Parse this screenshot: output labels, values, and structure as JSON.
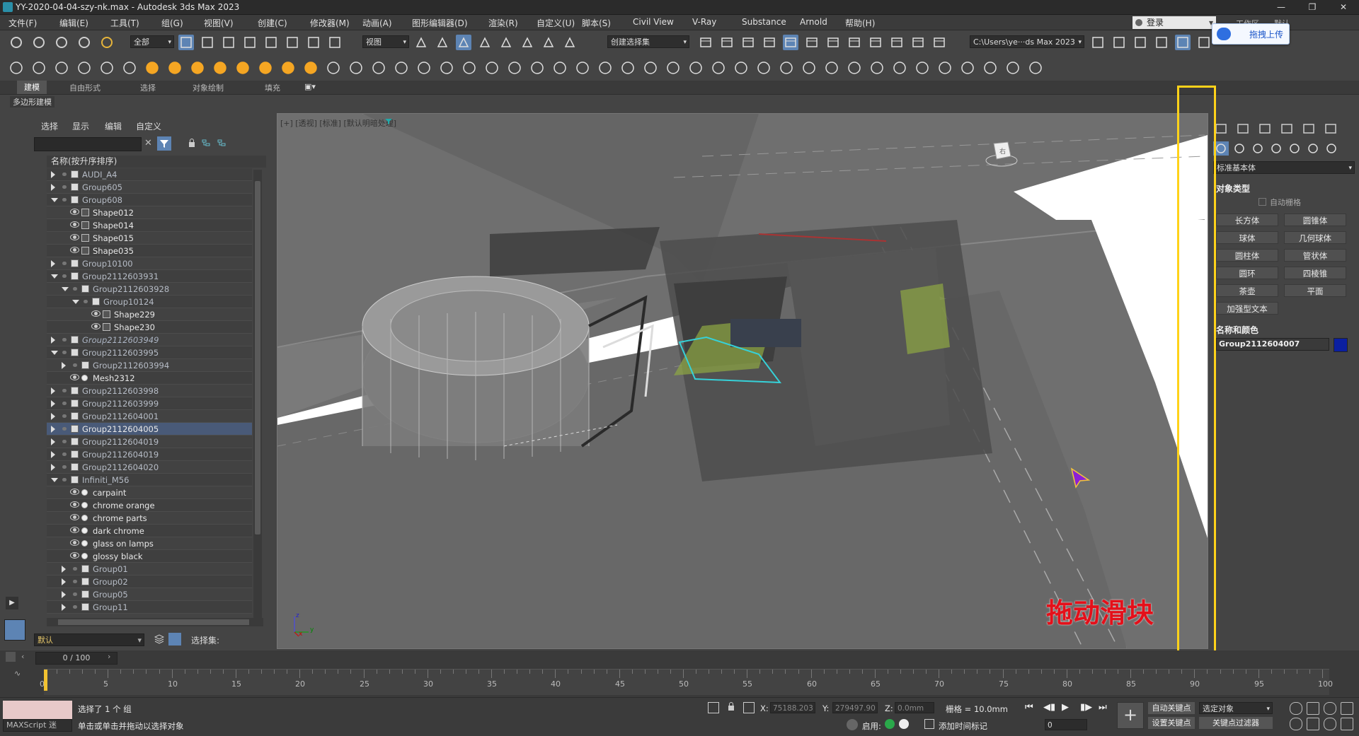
{
  "window": {
    "title": "YY-2020-04-04-szy-nk.max - Autodesk 3ds Max 2023",
    "minimize": "—",
    "restore": "❐",
    "close": "✕"
  },
  "menu": [
    "文件(F)",
    "编辑(E)",
    "工具(T)",
    "组(G)",
    "视图(V)",
    "创建(C)",
    "修改器(M)",
    "动画(A)",
    "图形编辑器(D)",
    "渲染(R)",
    "自定义(U)",
    "脚本(S)",
    "Civil View",
    "V-Ray",
    "Substance",
    "Arnold",
    "帮助(H)"
  ],
  "login": {
    "label": "登录",
    "right_tab": "工作区",
    "right_tab2": "默认"
  },
  "upload_popup": {
    "label": "拖拽上传"
  },
  "toolbar1": {
    "filter": "全部",
    "ref_coord": "视图",
    "selection_set": "创建选择集",
    "path": "C:\\Users\\ye···ds Max 2023"
  },
  "ribbon": {
    "tabs": [
      "建模",
      "自由形式",
      "选择",
      "对象绘制",
      "填充"
    ],
    "subtab": "多边形建模"
  },
  "scene_explorer": {
    "tabs": [
      "选择",
      "显示",
      "编辑",
      "自定义"
    ],
    "column_header": "名称(按升序排序)",
    "rows": [
      {
        "name": "AUDI_A4",
        "level": 0,
        "exp": "closed",
        "eye": false,
        "ic": "group",
        "style": "dim"
      },
      {
        "name": "Group605",
        "level": 0,
        "exp": "closed",
        "eye": false,
        "ic": "group",
        "style": "dim"
      },
      {
        "name": "Group608",
        "level": 0,
        "exp": "open",
        "eye": false,
        "ic": "group",
        "style": "dim"
      },
      {
        "name": "Shape012",
        "level": 1,
        "exp": "none",
        "eye": true,
        "ic": "shape",
        "style": "normal"
      },
      {
        "name": "Shape014",
        "level": 1,
        "exp": "none",
        "eye": true,
        "ic": "shape",
        "style": "normal"
      },
      {
        "name": "Shape015",
        "level": 1,
        "exp": "none",
        "eye": true,
        "ic": "shape",
        "style": "normal"
      },
      {
        "name": "Shape035",
        "level": 1,
        "exp": "none",
        "eye": true,
        "ic": "shape",
        "style": "normal"
      },
      {
        "name": "Group10100",
        "level": 0,
        "exp": "closed",
        "eye": false,
        "ic": "group",
        "style": "dim"
      },
      {
        "name": "Group2112603931",
        "level": 0,
        "exp": "open",
        "eye": false,
        "ic": "group",
        "style": "dim"
      },
      {
        "name": "Group2112603928",
        "level": 1,
        "exp": "open",
        "eye": false,
        "ic": "group",
        "style": "dim"
      },
      {
        "name": "Group10124",
        "level": 2,
        "exp": "open",
        "eye": false,
        "ic": "group",
        "style": "dim"
      },
      {
        "name": "Shape229",
        "level": 3,
        "exp": "none",
        "eye": true,
        "ic": "shape",
        "style": "normal"
      },
      {
        "name": "Shape230",
        "level": 3,
        "exp": "none",
        "eye": true,
        "ic": "shape",
        "style": "normal"
      },
      {
        "name": "Group2112603949",
        "level": 0,
        "exp": "closed",
        "eye": false,
        "ic": "group",
        "style": "it"
      },
      {
        "name": "Group2112603995",
        "level": 0,
        "exp": "open",
        "eye": false,
        "ic": "group",
        "style": "dim"
      },
      {
        "name": "Group2112603994",
        "level": 1,
        "exp": "closed",
        "eye": false,
        "ic": "group",
        "style": "dim"
      },
      {
        "name": "Mesh2312",
        "level": 1,
        "exp": "none",
        "eye": true,
        "ic": "mesh",
        "style": "normal"
      },
      {
        "name": "Group2112603998",
        "level": 0,
        "exp": "closed",
        "eye": false,
        "ic": "group",
        "style": "dim"
      },
      {
        "name": "Group2112603999",
        "level": 0,
        "exp": "closed",
        "eye": false,
        "ic": "group",
        "style": "dim"
      },
      {
        "name": "Group2112604001",
        "level": 0,
        "exp": "closed",
        "eye": false,
        "ic": "group",
        "style": "dim"
      },
      {
        "name": "Group2112604005",
        "level": 0,
        "exp": "closed",
        "eye": false,
        "ic": "group",
        "style": "sel"
      },
      {
        "name": "Group2112604019",
        "level": 0,
        "exp": "closed",
        "eye": false,
        "ic": "group",
        "style": "dim"
      },
      {
        "name": "Group2112604019",
        "level": 0,
        "exp": "closed",
        "eye": false,
        "ic": "group",
        "style": "dim"
      },
      {
        "name": "Group2112604020",
        "level": 0,
        "exp": "closed",
        "eye": false,
        "ic": "group",
        "style": "dim"
      },
      {
        "name": "Infiniti_M56",
        "level": 0,
        "exp": "open",
        "eye": false,
        "ic": "group",
        "style": "dim"
      },
      {
        "name": "carpaint",
        "level": 1,
        "exp": "none",
        "eye": true,
        "ic": "mat",
        "style": "normal"
      },
      {
        "name": "chrome orange",
        "level": 1,
        "exp": "none",
        "eye": true,
        "ic": "mat",
        "style": "normal"
      },
      {
        "name": "chrome parts",
        "level": 1,
        "exp": "none",
        "eye": true,
        "ic": "mat",
        "style": "normal"
      },
      {
        "name": "dark chrome",
        "level": 1,
        "exp": "none",
        "eye": true,
        "ic": "mat",
        "style": "normal"
      },
      {
        "name": "glass on lamps",
        "level": 1,
        "exp": "none",
        "eye": true,
        "ic": "mat",
        "style": "normal"
      },
      {
        "name": "glossy black",
        "level": 1,
        "exp": "none",
        "eye": true,
        "ic": "mat",
        "style": "normal"
      },
      {
        "name": "Group01",
        "level": 1,
        "exp": "closed",
        "eye": false,
        "ic": "group",
        "style": "dim"
      },
      {
        "name": "Group02",
        "level": 1,
        "exp": "closed",
        "eye": false,
        "ic": "group",
        "style": "dim"
      },
      {
        "name": "Group05",
        "level": 1,
        "exp": "closed",
        "eye": false,
        "ic": "group",
        "style": "dim"
      },
      {
        "name": "Group11",
        "level": 1,
        "exp": "closed",
        "eye": false,
        "ic": "group",
        "style": "dim"
      }
    ],
    "layer_default": "默认",
    "selection_set_label": "选择集:"
  },
  "viewport": {
    "label": "[+] [透视] [标准] [默认明暗处理]",
    "axis_x": "x",
    "axis_y": "y",
    "axis_z": "z",
    "viewcube": "右"
  },
  "command_panel": {
    "category": "标准基本体",
    "section_object_type": "对象类型",
    "autogrid": "自动栅格",
    "buttons": [
      "长方体",
      "圆锥体",
      "球体",
      "几何球体",
      "圆柱体",
      "管状体",
      "圆环",
      "四棱锥",
      "茶壶",
      "平面",
      "加强型文本"
    ],
    "section_name_color": "名称和颜色",
    "object_name": "Group2112604007",
    "object_color": "#0b1fa0"
  },
  "annotation": {
    "text": "拖动滑块",
    "color": "#ffd21a"
  },
  "timeline": {
    "slider": "0 / 100",
    "labels": [
      "0",
      "5",
      "10",
      "15",
      "20",
      "25",
      "30",
      "35",
      "40",
      "45",
      "50",
      "55",
      "60",
      "65",
      "70",
      "75",
      "80",
      "85",
      "90",
      "95",
      "100"
    ]
  },
  "status": {
    "maxscript": "MAXScript 迷",
    "selected": "选择了 1 个 组",
    "hint": "单击或单击并拖动以选择对象",
    "x_label": "X:",
    "x_val": "75188.203",
    "y_label": "Y:",
    "y_val": "279497.90",
    "z_label": "Z:",
    "z_val": "0.0mm",
    "grid": "栅格 = 10.0mm",
    "enable": "启用:",
    "add_time_tag": "添加时间标记",
    "auto_key": "自动关键点",
    "set_key": "设置关键点",
    "sel_object": "选定对象",
    "key_filter": "关键点过滤器",
    "frame": "0"
  }
}
